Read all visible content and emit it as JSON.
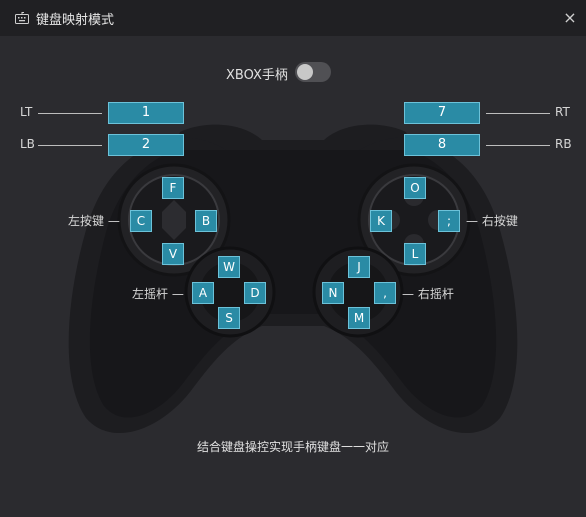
{
  "window": {
    "title": "键盘映射模式",
    "close_glyph": "×"
  },
  "xbox": {
    "label": "XBOX手柄",
    "enabled": false
  },
  "triggers": {
    "lt": {
      "label": "LT",
      "key": "1"
    },
    "lb": {
      "label": "LB",
      "key": "2"
    },
    "rt": {
      "label": "RT",
      "key": "7"
    },
    "rb": {
      "label": "RB",
      "key": "8"
    }
  },
  "left_buttons": {
    "label": "左按键",
    "up": "F",
    "left": "C",
    "right": "B",
    "down": "V"
  },
  "left_stick": {
    "label": "左摇杆",
    "up": "W",
    "left": "A",
    "right": "D",
    "down": "S"
  },
  "right_buttons": {
    "label": "右按键",
    "up": "O",
    "left": "K",
    "right": ";",
    "down": "L"
  },
  "right_stick": {
    "label": "右摇杆",
    "up": "J",
    "left": "N",
    "right": ",",
    "down": "M"
  },
  "hint": "结合键盘操控实现手柄键盘一一对应"
}
